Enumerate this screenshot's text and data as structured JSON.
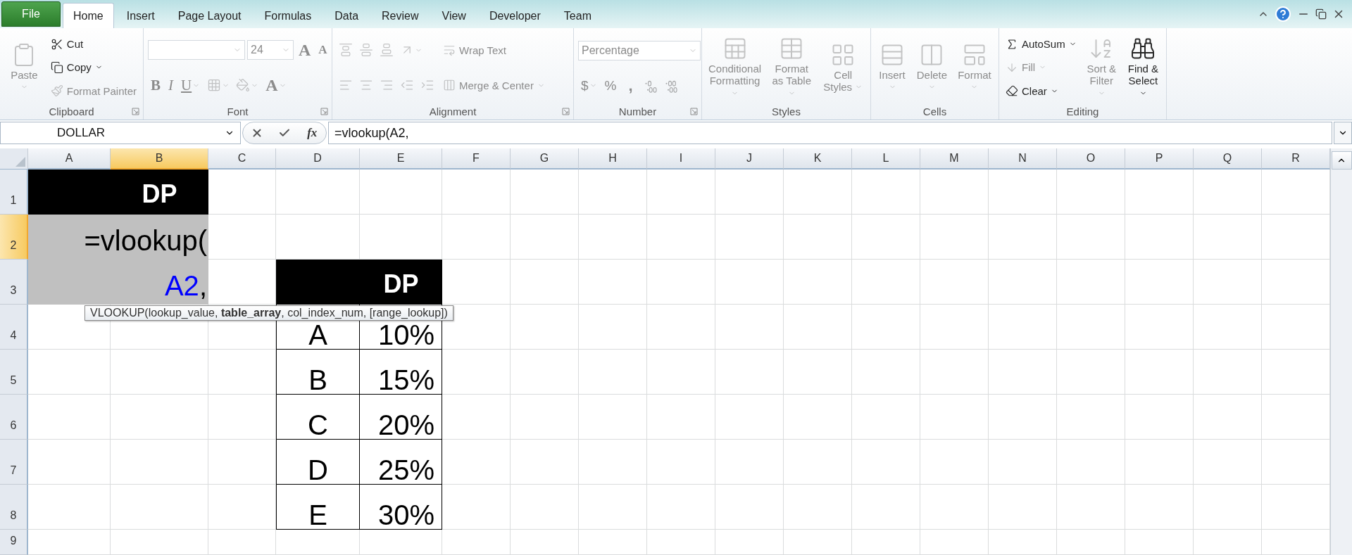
{
  "file_tab": "File",
  "tabs": [
    {
      "label": "Home",
      "selected": true
    },
    {
      "label": "Insert",
      "selected": false
    },
    {
      "label": "Page Layout",
      "selected": false
    },
    {
      "label": "Formulas",
      "selected": false
    },
    {
      "label": "Data",
      "selected": false
    },
    {
      "label": "Review",
      "selected": false
    },
    {
      "label": "View",
      "selected": false
    },
    {
      "label": "Developer",
      "selected": false
    },
    {
      "label": "Team",
      "selected": false
    }
  ],
  "ribbon": {
    "groups": [
      {
        "label": "Clipboard",
        "launcher": true,
        "items": [
          {
            "kind": "large",
            "label": "Paste",
            "disabled": true,
            "dropdown": true
          },
          {
            "kind": "small",
            "label": "Cut",
            "disabled": false,
            "dropdown": false
          },
          {
            "kind": "small",
            "label": "Copy",
            "disabled": false,
            "dropdown": true
          },
          {
            "kind": "small",
            "label": "Format Painter",
            "disabled": true,
            "dropdown": false
          }
        ]
      },
      {
        "label": "Font",
        "launcher": true,
        "items": [
          {
            "kind": "combo",
            "disabled": true
          },
          {
            "kind": "combo",
            "value": "24",
            "disabled": true
          },
          {
            "kind": "glyph",
            "label": "A",
            "disabled": true,
            "dropdown": false
          },
          {
            "kind": "glyph",
            "label": "A",
            "disabled": true,
            "dropdown": false
          },
          {
            "kind": "glyph",
            "label": "B",
            "disabled": true,
            "dropdown": false
          },
          {
            "kind": "glyph",
            "label": "I",
            "disabled": true,
            "dropdown": false
          },
          {
            "kind": "glyph",
            "label": "U",
            "disabled": true,
            "dropdown": true
          },
          {
            "kind": "icon",
            "disabled": true,
            "dropdown": true
          },
          {
            "kind": "icon",
            "disabled": true,
            "dropdown": true
          },
          {
            "kind": "glyph",
            "label": "A",
            "disabled": true,
            "dropdown": true
          }
        ]
      },
      {
        "label": "Alignment",
        "launcher": true,
        "items": [
          {
            "kind": "icon",
            "disabled": true,
            "dropdown": false
          },
          {
            "kind": "icon",
            "disabled": true,
            "dropdown": false
          },
          {
            "kind": "icon",
            "disabled": true,
            "dropdown": false
          },
          {
            "kind": "icon",
            "disabled": true,
            "dropdown": true
          },
          {
            "kind": "small",
            "label": "Wrap Text",
            "disabled": true,
            "dropdown": false
          },
          {
            "kind": "icon",
            "disabled": true,
            "dropdown": false
          },
          {
            "kind": "icon",
            "disabled": true,
            "dropdown": false
          },
          {
            "kind": "icon",
            "disabled": true,
            "dropdown": false
          },
          {
            "kind": "icon",
            "disabled": true,
            "dropdown": false
          },
          {
            "kind": "icon",
            "disabled": true,
            "dropdown": false
          },
          {
            "kind": "small",
            "label": "Merge & Center",
            "disabled": true,
            "dropdown": true
          }
        ]
      },
      {
        "label": "Number",
        "launcher": true,
        "items": [
          {
            "kind": "combo",
            "value": "Percentage",
            "disabled": true
          },
          {
            "kind": "glyph",
            "label": "$",
            "disabled": true,
            "dropdown": true
          },
          {
            "kind": "glyph",
            "label": "%",
            "disabled": true,
            "dropdown": false
          },
          {
            "kind": "glyph",
            "label": ",",
            "disabled": true,
            "dropdown": false
          },
          {
            "kind": "icon",
            "disabled": true,
            "dropdown": false
          },
          {
            "kind": "icon",
            "disabled": true,
            "dropdown": false
          }
        ]
      },
      {
        "label": "Styles",
        "launcher": false,
        "items": [
          {
            "kind": "large",
            "label": "Conditional Formatting",
            "disabled": true,
            "dropdown": true
          },
          {
            "kind": "large",
            "label": "Format as Table",
            "disabled": true,
            "dropdown": true
          },
          {
            "kind": "large",
            "label": "Cell Styles",
            "disabled": true,
            "dropdown": true
          }
        ]
      },
      {
        "label": "Cells",
        "launcher": false,
        "items": [
          {
            "kind": "large",
            "label": "Insert",
            "disabled": true,
            "dropdown": true
          },
          {
            "kind": "large",
            "label": "Delete",
            "disabled": true,
            "dropdown": true
          },
          {
            "kind": "large",
            "label": "Format",
            "disabled": true,
            "dropdown": true
          }
        ]
      },
      {
        "label": "Editing",
        "launcher": false,
        "items": [
          {
            "kind": "small",
            "label": "AutoSum",
            "disabled": false,
            "dropdown": true
          },
          {
            "kind": "small",
            "label": "Fill",
            "disabled": true,
            "dropdown": true
          },
          {
            "kind": "small",
            "label": "Clear",
            "disabled": false,
            "dropdown": true
          },
          {
            "kind": "large",
            "label": "Sort & Filter",
            "disabled": true,
            "dropdown": true
          },
          {
            "kind": "large",
            "label": "Find & Select",
            "disabled": false,
            "dropdown": true
          }
        ]
      }
    ]
  },
  "formula_bar": {
    "name_box": "DOLLAR",
    "function_label": "fx",
    "formula": "=vlookup(A2,"
  },
  "sheet": {
    "columns": [
      {
        "label": "A",
        "selected": false
      },
      {
        "label": "B",
        "selected": true
      },
      {
        "label": "C",
        "selected": false
      },
      {
        "label": "D",
        "selected": false
      },
      {
        "label": "E",
        "selected": false
      },
      {
        "label": "F",
        "selected": false
      },
      {
        "label": "G",
        "selected": false
      },
      {
        "label": "H",
        "selected": false
      },
      {
        "label": "I",
        "selected": false
      },
      {
        "label": "J",
        "selected": false
      },
      {
        "label": "K",
        "selected": false
      },
      {
        "label": "L",
        "selected": false
      },
      {
        "label": "M",
        "selected": false
      },
      {
        "label": "N",
        "selected": false
      },
      {
        "label": "O",
        "selected": false
      },
      {
        "label": "P",
        "selected": false
      },
      {
        "label": "Q",
        "selected": false
      },
      {
        "label": "R",
        "selected": false
      }
    ],
    "rows": [
      {
        "label": "1",
        "selected": false
      },
      {
        "label": "2",
        "selected": true
      },
      {
        "label": "3",
        "selected": false
      },
      {
        "label": "4",
        "selected": false
      },
      {
        "label": "5",
        "selected": false
      },
      {
        "label": "6",
        "selected": false
      },
      {
        "label": "7",
        "selected": false
      },
      {
        "label": "8",
        "selected": false
      },
      {
        "label": "9",
        "selected": false
      }
    ],
    "title_band": {
      "text": "DP"
    },
    "cell_editor": {
      "line_1": "=vlookup(",
      "reference": "A2",
      "line_2_rest": ","
    },
    "lookup_table": {
      "header": "DP",
      "rows": [
        {
          "key": "A",
          "value": "10%"
        },
        {
          "key": "B",
          "value": "15%"
        },
        {
          "key": "C",
          "value": "20%"
        },
        {
          "key": "D",
          "value": "25%"
        },
        {
          "key": "E",
          "value": "30%"
        }
      ]
    },
    "tooltip": "VLOOKUP(lookup_value, **table_array**, col_index_num, [range_lookup])"
  }
}
